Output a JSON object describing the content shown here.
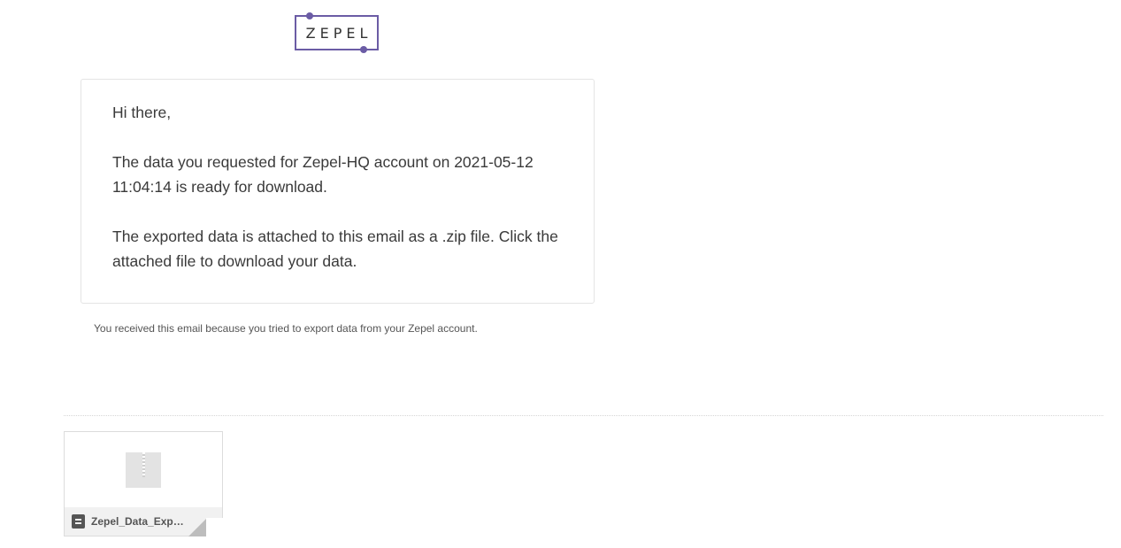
{
  "logo": {
    "text": "ZEPEL"
  },
  "email": {
    "greeting": "Hi there,",
    "paragraph1": "The data you requested for Zepel-HQ account on 2021-05-12 11:04:14 is ready for download.",
    "paragraph2": "The exported data is attached to this email as a .zip file. Click the attached file to download your data.",
    "footnote": "You received this email because you tried to export data from your Zepel account."
  },
  "attachment": {
    "filename": "Zepel_Data_Export...",
    "icon": "zip-file-icon",
    "type_icon": "document-icon"
  },
  "colors": {
    "brand": "#6b5ca5"
  }
}
